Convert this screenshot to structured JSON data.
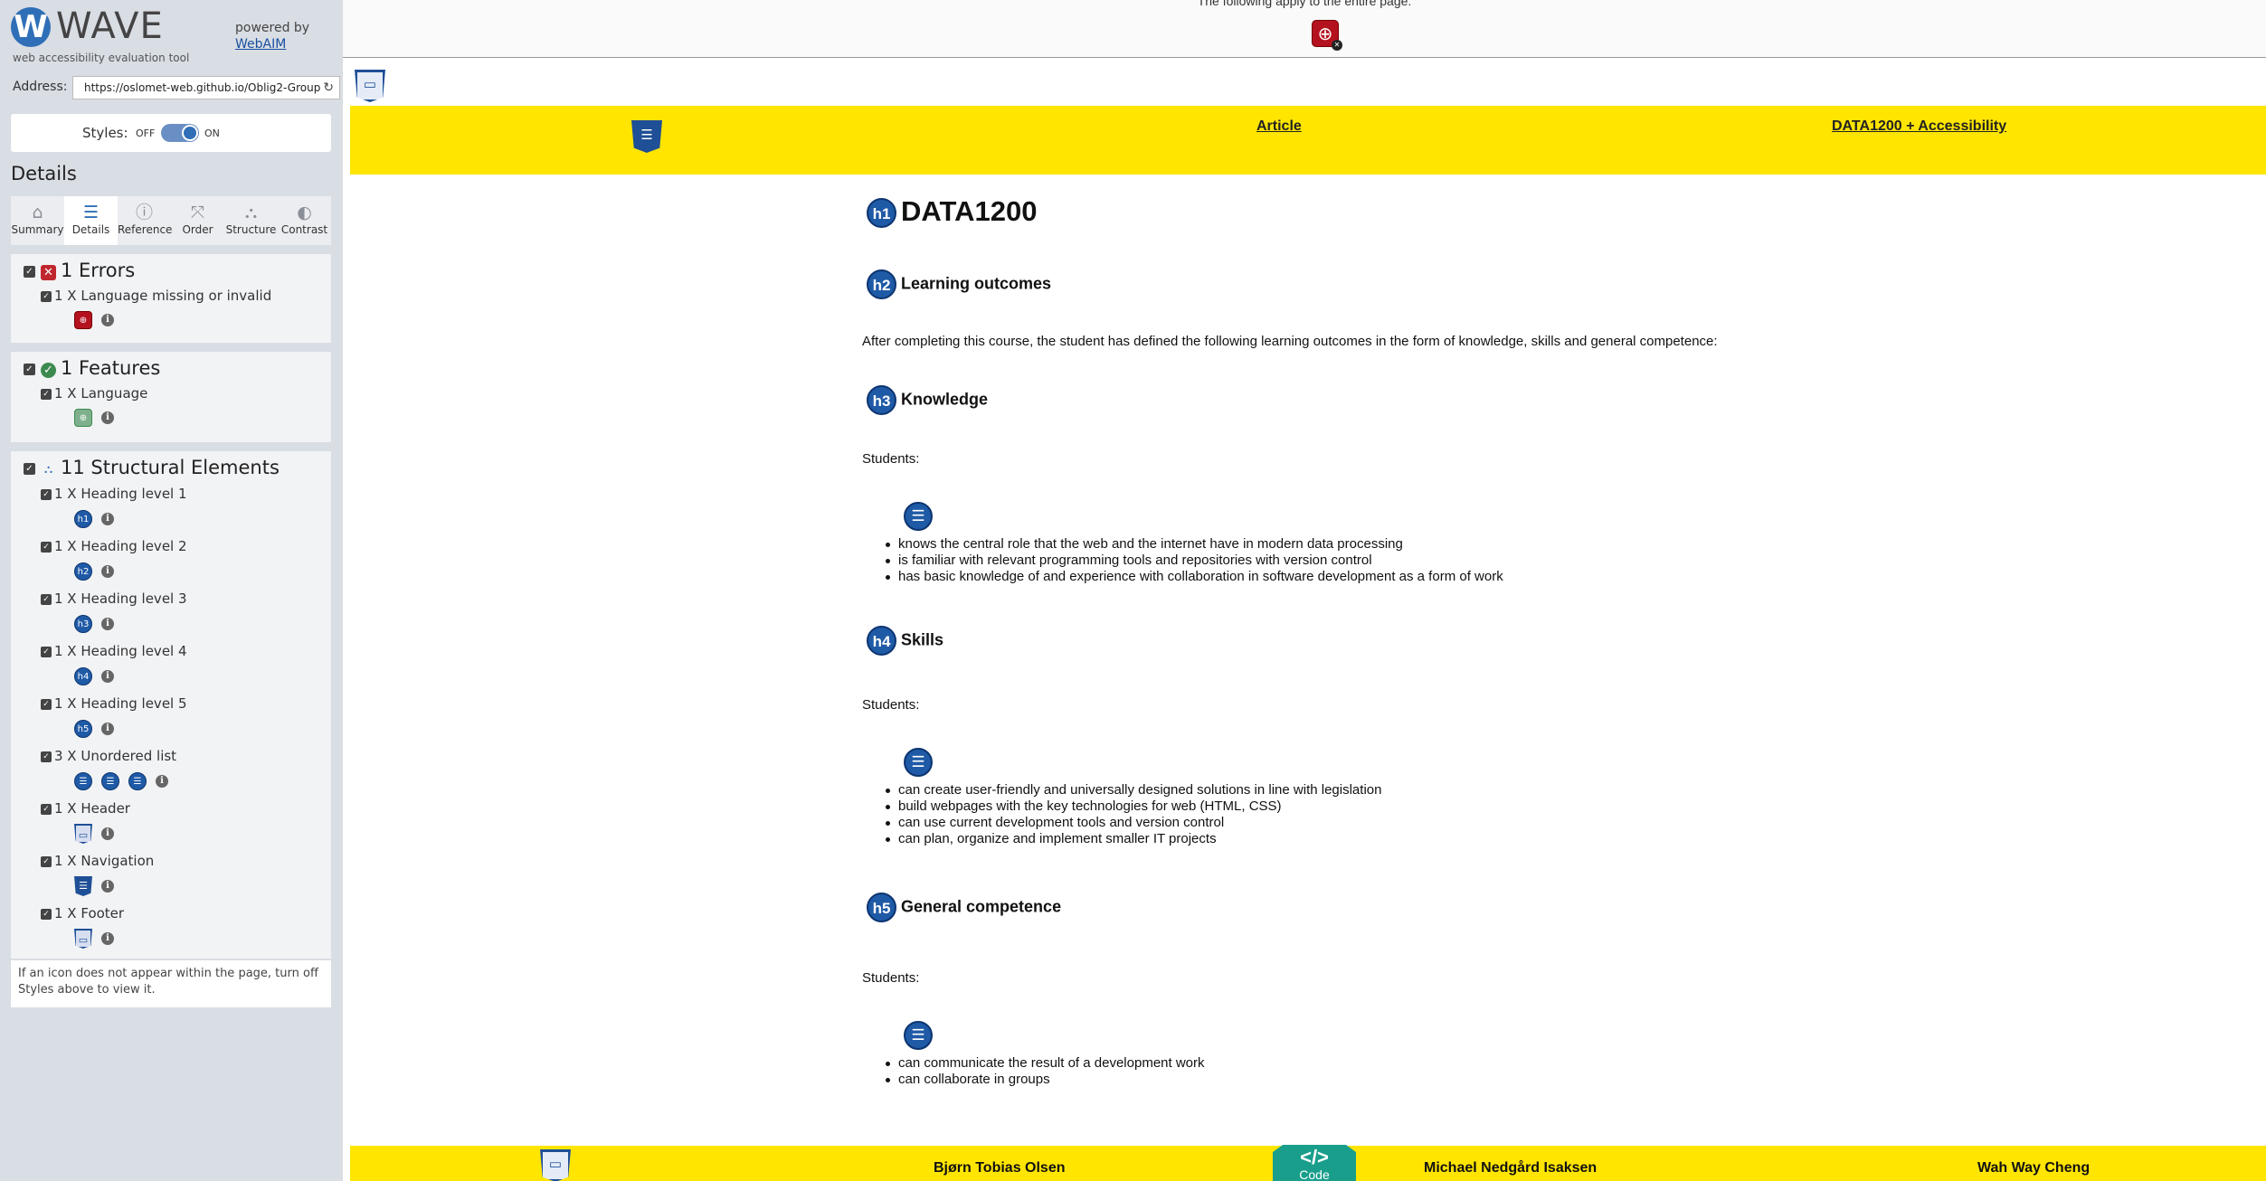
{
  "wave": {
    "logo_letter": "W",
    "logo_title": "WAVE",
    "logo_subtitle": "web accessibility evaluation tool",
    "powered_by": "powered by",
    "powered_link": "WebAIM",
    "address_label": "Address:",
    "address_value": "https://oslomet-web.github.io/Oblig2-Group",
    "styles_label": "Styles:",
    "styles_off": "OFF",
    "styles_on": "ON",
    "details_title": "Details",
    "tabs": [
      {
        "label": "Summary",
        "icon": "home-icon",
        "glyph": "⌂"
      },
      {
        "label": "Details",
        "icon": "list-icon",
        "glyph": "☰"
      },
      {
        "label": "Reference",
        "icon": "info-icon",
        "glyph": "ⓘ"
      },
      {
        "label": "Order",
        "icon": "order-icon",
        "glyph": "⤧"
      },
      {
        "label": "Structure",
        "icon": "structure-icon",
        "glyph": "⛬"
      },
      {
        "label": "Contrast",
        "icon": "contrast-icon",
        "glyph": "◐"
      }
    ],
    "errors": {
      "title": "1 Errors",
      "item": "1 X Language missing or invalid"
    },
    "features": {
      "title": "1 Features",
      "item": "1 X Language"
    },
    "structure": {
      "title": "11 Structural Elements",
      "items": [
        "1 X Heading level 1",
        "1 X Heading level 2",
        "1 X Heading level 3",
        "1 X Heading level 4",
        "1 X Heading level 5",
        "3 X Unordered list",
        "1 X Header",
        "1 X Navigation",
        "1 X Footer"
      ],
      "icons": [
        "h1",
        "h2",
        "h3",
        "h4",
        "h5"
      ]
    },
    "note": "If an icon does not appear within the page, turn off Styles above to view it.",
    "colors": {
      "accent": "#2f6fb7",
      "error": "#b4121f",
      "feature": "#3c8a4e"
    }
  },
  "page": {
    "top_notice": "The following apply to the entire page:",
    "nav_links": [
      "Article",
      "DATA1200 + Accessibility"
    ],
    "h1": "DATA1200",
    "h2": "Learning outcomes",
    "intro": "After completing this course, the student has defined the following learning outcomes in the form of knowledge, skills and general competence:",
    "h3": "Knowledge",
    "students_label": "Students:",
    "knowledge_items": [
      "knows the central role that the web and the internet have in modern data processing",
      "is familiar with relevant programming tools and repositories with version control",
      "has basic knowledge of and experience with collaboration in software development as a form of work"
    ],
    "h4": "Skills",
    "skills_items": [
      "can create user-friendly and universally designed solutions in line with legislation",
      "build webpages with the key technologies for web (HTML, CSS)",
      "can use current development tools and version control",
      "can plan, organize and implement smaller IT projects"
    ],
    "h5": "General competence",
    "competence_items": [
      "can communicate the result of a development work",
      "can collaborate in groups"
    ],
    "footer_names": [
      "Bjørn Tobias Olsen",
      "Michael Nedgård Isaksen",
      "Wah Way Cheng"
    ],
    "code_badge": "Code",
    "colors": {
      "highlight": "#ffe500",
      "badge": "#1a9e8c"
    }
  }
}
